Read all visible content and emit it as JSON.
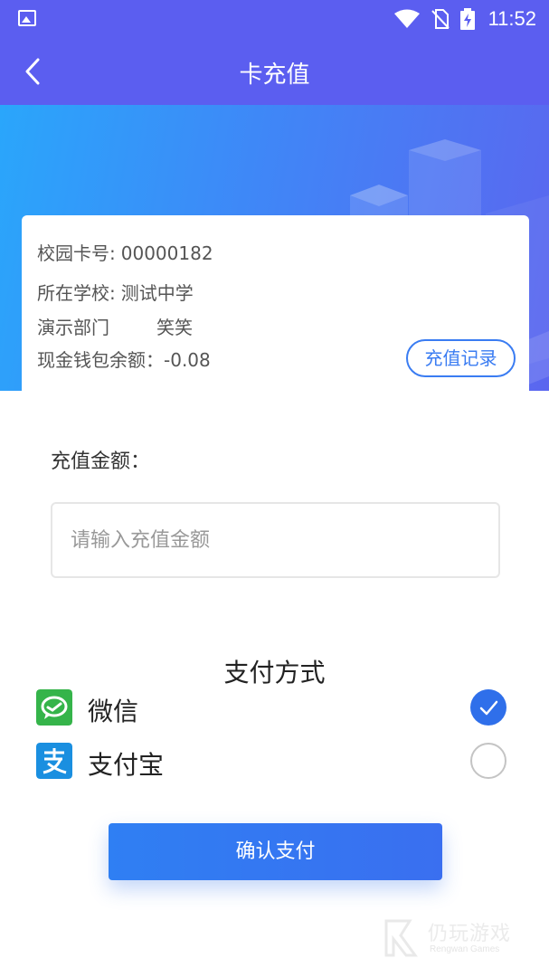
{
  "status_bar": {
    "time": "11:52",
    "icons": [
      "image-icon",
      "wifi-icon",
      "no-sim-icon",
      "battery-charging-icon"
    ]
  },
  "header": {
    "title": "卡充值",
    "back_icon": "back-arrow-icon"
  },
  "card": {
    "card_number_label": "校园卡号:",
    "card_number": "00000182",
    "school_label": "所在学校:",
    "school": "测试中学",
    "department": "演示部门",
    "name": "笑笑",
    "balance_label": "现金钱包余额：",
    "balance": "-0.08",
    "record_button": "充值记录"
  },
  "recharge": {
    "amount_label": "充值金额：",
    "amount_value": "",
    "amount_placeholder": "请输入充值金额"
  },
  "payment": {
    "title": "支付方式",
    "methods": [
      {
        "label": "微信",
        "icon": "wechat-icon",
        "selected": true,
        "color": "#35b44a"
      },
      {
        "label": "支付宝",
        "icon": "alipay-icon",
        "selected": false,
        "color": "#1a8fe0"
      }
    ]
  },
  "confirm_button": "确认支付",
  "watermark": {
    "cn": "仍玩游戏",
    "en": "Rengwan Games"
  },
  "colors": {
    "primary": "#5b5ef0",
    "accent": "#2f6fea",
    "banner_start": "#2aa6fb",
    "banner_end": "#5b66ef"
  }
}
